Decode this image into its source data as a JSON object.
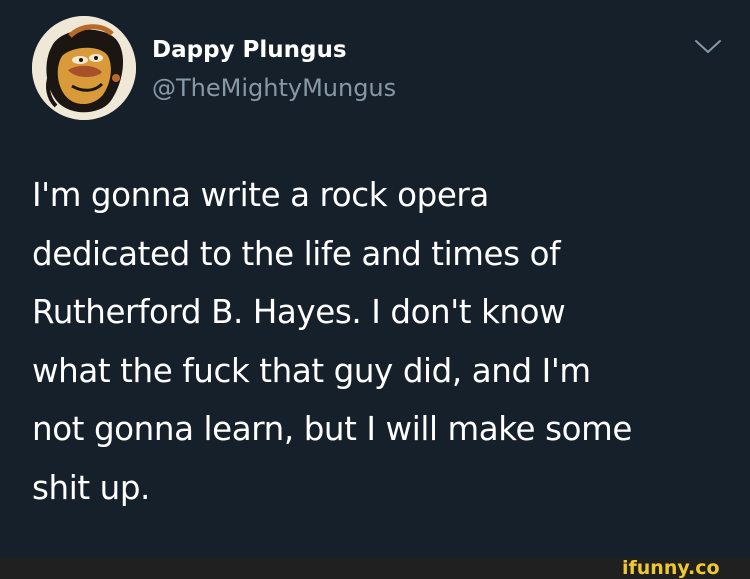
{
  "tweet": {
    "display_name": "Dappy Plungus",
    "handle": "@TheMightyMungus",
    "text": "I'm gonna write a rock opera\ndedicated to the life and times of\nRutherford B. Hayes. I don't know\nwhat the fuck that guy did, and I'm\nnot gonna learn, but I will make some\nshit up."
  },
  "icons": {
    "menu": "chevron-down-icon",
    "avatar": "cartoon-face-avatar"
  },
  "watermark": {
    "text": "ifunny.co"
  },
  "colors": {
    "background": "#15202b",
    "text_primary": "#ffffff",
    "text_secondary": "#8899a6",
    "watermark": "#f0c92e",
    "footer_bar": "#202020"
  }
}
